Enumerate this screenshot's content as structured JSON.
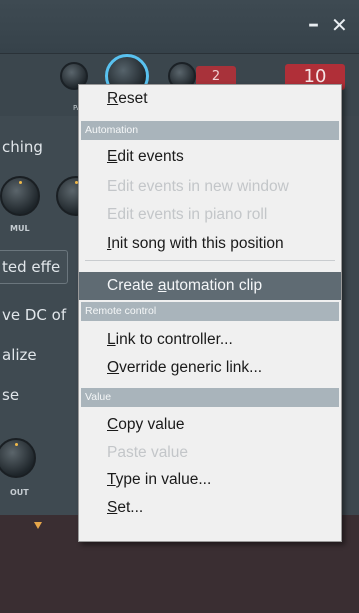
{
  "window": {
    "minimize_glyph": "–",
    "close_glyph": "✕"
  },
  "knobs": {
    "pa_label": "PA",
    "tab_value": "2",
    "number_value": "10"
  },
  "left_panel": {
    "line1": "ching",
    "mul_label": "MUL",
    "line2": "ted effe",
    "line3": "ve DC of",
    "line4": "alize",
    "line5": "se",
    "out_label": "OUT"
  },
  "menu": {
    "items": [
      {
        "label": "Reset",
        "u": "R",
        "rest": "eset"
      },
      {
        "header": "Automation"
      },
      {
        "label": "Edit events",
        "u": "E",
        "rest": "dit events"
      },
      {
        "label": "Edit events in new window",
        "disabled": true
      },
      {
        "label": "Edit events in piano roll",
        "disabled": true
      },
      {
        "label": "Init song with this position",
        "u": "I",
        "rest": "nit song with this position"
      },
      {
        "label": "Create automation clip",
        "pre": "Create ",
        "u": "a",
        "rest": "utomation clip",
        "highlight": true
      },
      {
        "header": "Remote control"
      },
      {
        "label": "Link to controller...",
        "u": "L",
        "rest": "ink to controller..."
      },
      {
        "label": "Override generic link...",
        "u": "O",
        "rest": "verride generic link..."
      },
      {
        "header": "Value"
      },
      {
        "label": "Copy value",
        "u": "C",
        "rest": "opy value"
      },
      {
        "label": "Paste value",
        "disabled": true
      },
      {
        "label": "Type in value...",
        "u": "T",
        "rest": "ype in value..."
      },
      {
        "label": "Set...",
        "u": "S",
        "rest": "et..."
      }
    ]
  }
}
